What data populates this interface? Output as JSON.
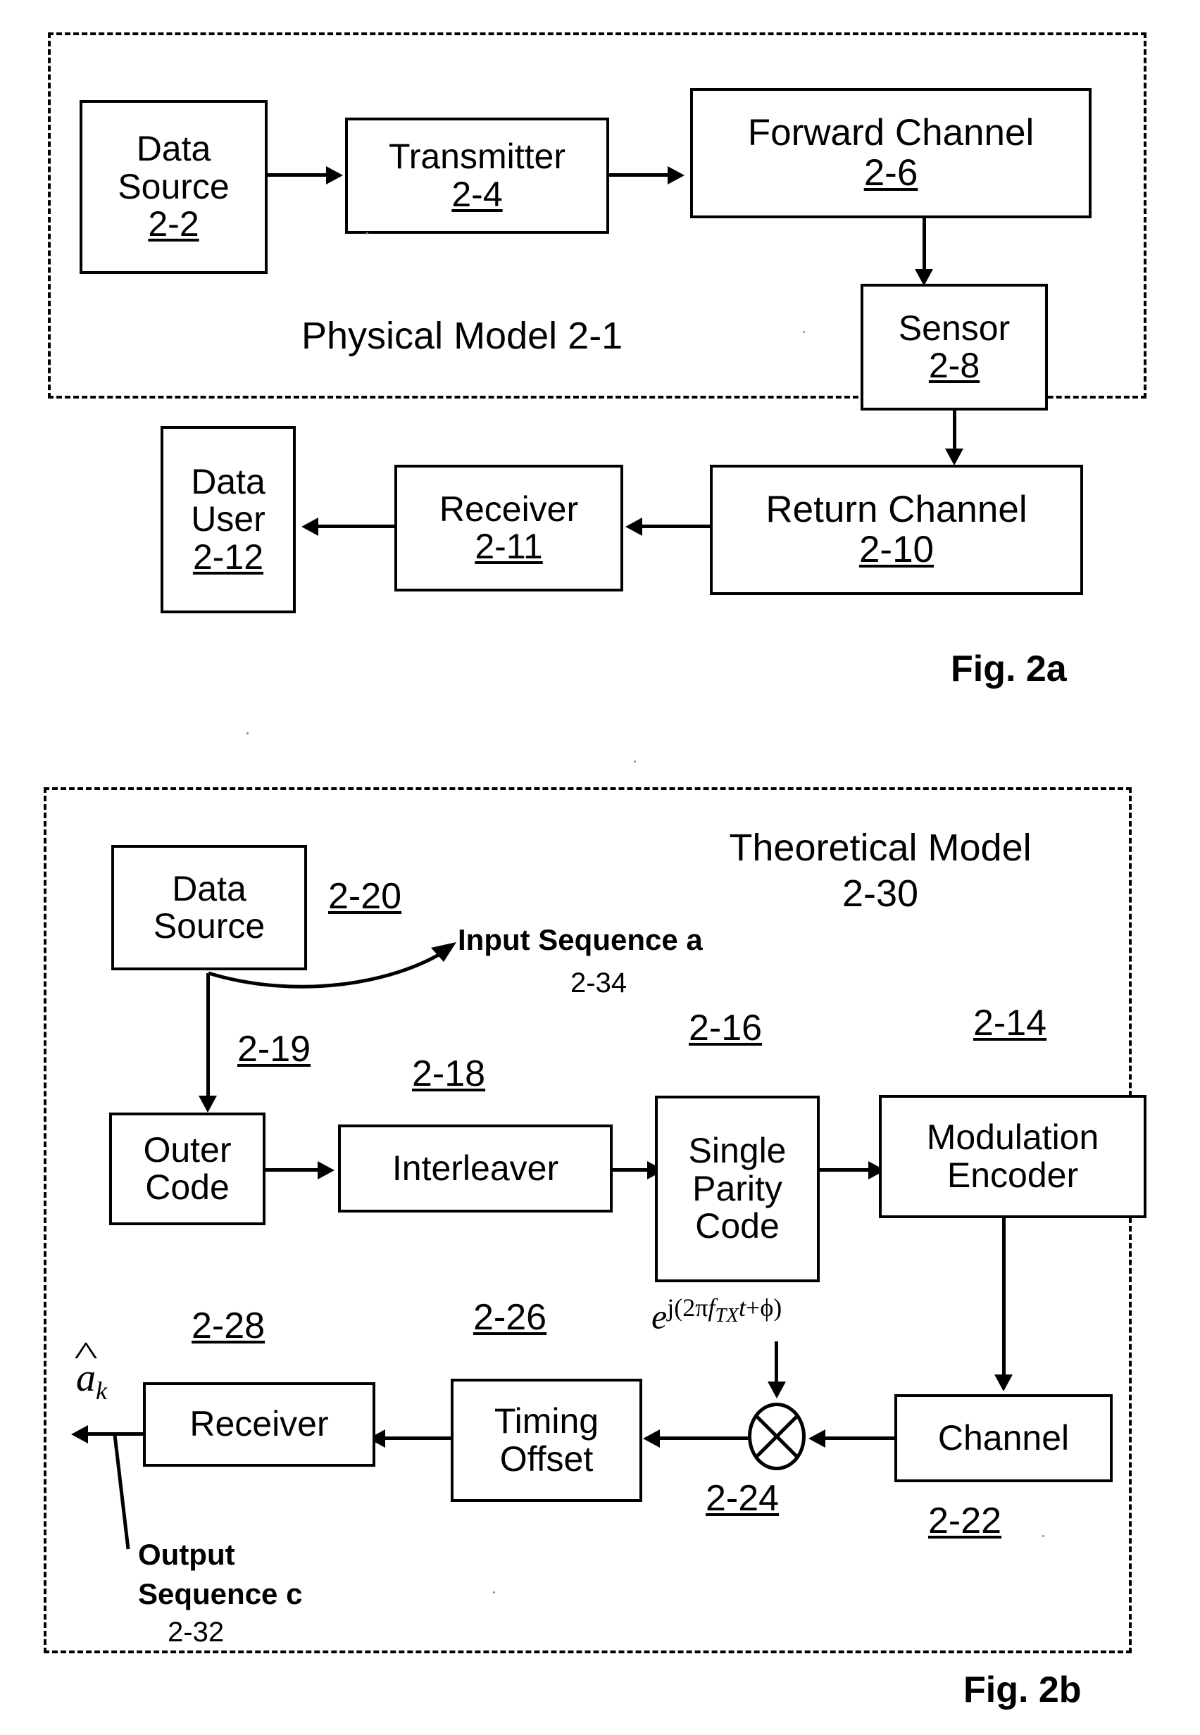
{
  "figure_2a": {
    "enclosure_label": "Physical Model",
    "enclosure_ref": "2-1",
    "caption": "Fig. 2a",
    "blocks": [
      {
        "name": "data-source",
        "title_line1": "Data",
        "title_line2": "Source",
        "ref": "2-2"
      },
      {
        "name": "transmitter",
        "title_line1": "Transmitter",
        "title_line2": "",
        "ref": "2-4"
      },
      {
        "name": "forward-channel",
        "title_line1": "Forward Channel",
        "title_line2": "",
        "ref": "2-6"
      },
      {
        "name": "sensor",
        "title_line1": "Sensor",
        "title_line2": "",
        "ref": "2-8"
      },
      {
        "name": "return-channel",
        "title_line1": "Return Channel",
        "title_line2": "",
        "ref": "2-10"
      },
      {
        "name": "receiver",
        "title_line1": "Receiver",
        "title_line2": "",
        "ref": "2-11"
      },
      {
        "name": "data-user",
        "title_line1": "Data",
        "title_line2": "User",
        "ref": "2-12"
      }
    ]
  },
  "figure_2b": {
    "enclosure_label_line1": "Theoretical Model",
    "enclosure_ref": "2-30",
    "caption": "Fig. 2b",
    "blocks": [
      {
        "name": "data-source",
        "title_line1": "Data",
        "title_line2": "Source",
        "ref": "2-20"
      },
      {
        "name": "outer-code",
        "title_line1": "Outer",
        "title_line2": "Code",
        "ref": "2-19"
      },
      {
        "name": "interleaver",
        "title_line1": "Interleaver",
        "title_line2": "",
        "ref": "2-18"
      },
      {
        "name": "single-parity-code",
        "title_line1": "Single",
        "title_line2": "Parity",
        "title_line3": "Code",
        "ref": "2-16"
      },
      {
        "name": "modulation-encoder",
        "title_line1": "Modulation",
        "title_line2": "Encoder",
        "ref": "2-14"
      },
      {
        "name": "channel",
        "title_line1": "Channel",
        "title_line2": "",
        "ref": "2-22"
      },
      {
        "name": "multiplier",
        "title_line1": "",
        "title_line2": "",
        "ref": "2-24"
      },
      {
        "name": "timing-offset",
        "title_line1": "Timing",
        "title_line2": "Offset",
        "ref": "2-26"
      },
      {
        "name": "receiver",
        "title_line1": "Receiver",
        "title_line2": "",
        "ref": "2-28"
      }
    ],
    "annotations": {
      "input_sequence_label": "Input Sequence a",
      "input_sequence_ref": "2-34",
      "output_sequence_line1": "Output",
      "output_sequence_line2": "Sequence c",
      "output_sequence_ref": "2-32",
      "carrier_expression": "e^{j(2πf_TX t + ϕ)}",
      "carrier_base": "e",
      "carrier_exp_open": "j(2",
      "carrier_exp_pi": "π",
      "carrier_exp_f": "f",
      "carrier_exp_fsub": "TX",
      "carrier_exp_t": "t",
      "carrier_exp_plus": "+",
      "carrier_exp_phi": "ϕ",
      "carrier_exp_close": ")",
      "estimate_symbol_base": "a",
      "estimate_symbol_sub": "k"
    }
  },
  "colors": {
    "ink": "#000000",
    "paper": "#ffffff"
  }
}
